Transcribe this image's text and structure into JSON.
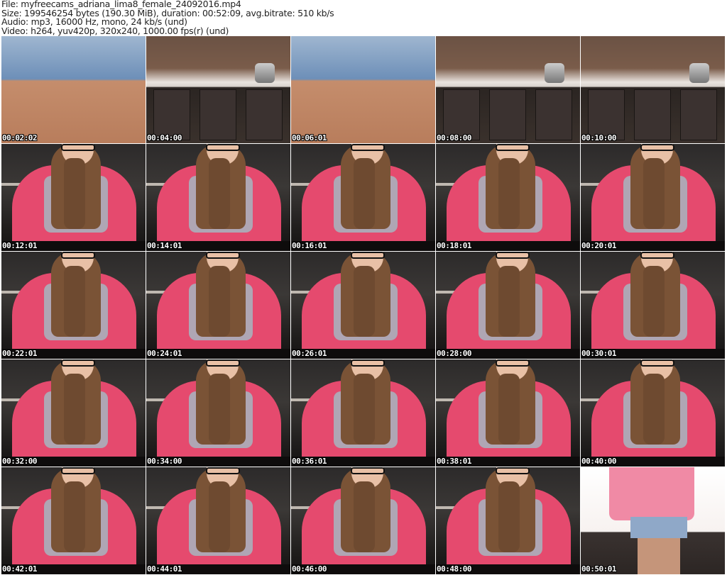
{
  "header": {
    "file_line": "File: myfreecams_adriana_lima8_female_24092016.mp4",
    "size_line": "Size: 199546254 bytes (190.30 MiB), duration: 00:52:09, avg.bitrate: 510 kb/s",
    "audio_line": "Audio: mp3, 16000 Hz, mono, 24 kb/s (und)",
    "video_line": "Video: h264, yuv420p, 320x240, 1000.00 fps(r) (und)"
  },
  "thumbnails": [
    {
      "timestamp": "00:02:02"
    },
    {
      "timestamp": "00:04:00"
    },
    {
      "timestamp": "00:06:01"
    },
    {
      "timestamp": "00:08:00"
    },
    {
      "timestamp": "00:10:00"
    },
    {
      "timestamp": "00:12:01"
    },
    {
      "timestamp": "00:14:01"
    },
    {
      "timestamp": "00:16:01"
    },
    {
      "timestamp": "00:18:01"
    },
    {
      "timestamp": "00:20:01"
    },
    {
      "timestamp": "00:22:01"
    },
    {
      "timestamp": "00:24:01"
    },
    {
      "timestamp": "00:26:01"
    },
    {
      "timestamp": "00:28:00"
    },
    {
      "timestamp": "00:30:01"
    },
    {
      "timestamp": "00:32:00"
    },
    {
      "timestamp": "00:34:00"
    },
    {
      "timestamp": "00:36:01"
    },
    {
      "timestamp": "00:38:01"
    },
    {
      "timestamp": "00:40:00"
    },
    {
      "timestamp": "00:42:01"
    },
    {
      "timestamp": "00:44:01"
    },
    {
      "timestamp": "00:46:00"
    },
    {
      "timestamp": "00:48:00"
    },
    {
      "timestamp": "00:50:01"
    }
  ]
}
